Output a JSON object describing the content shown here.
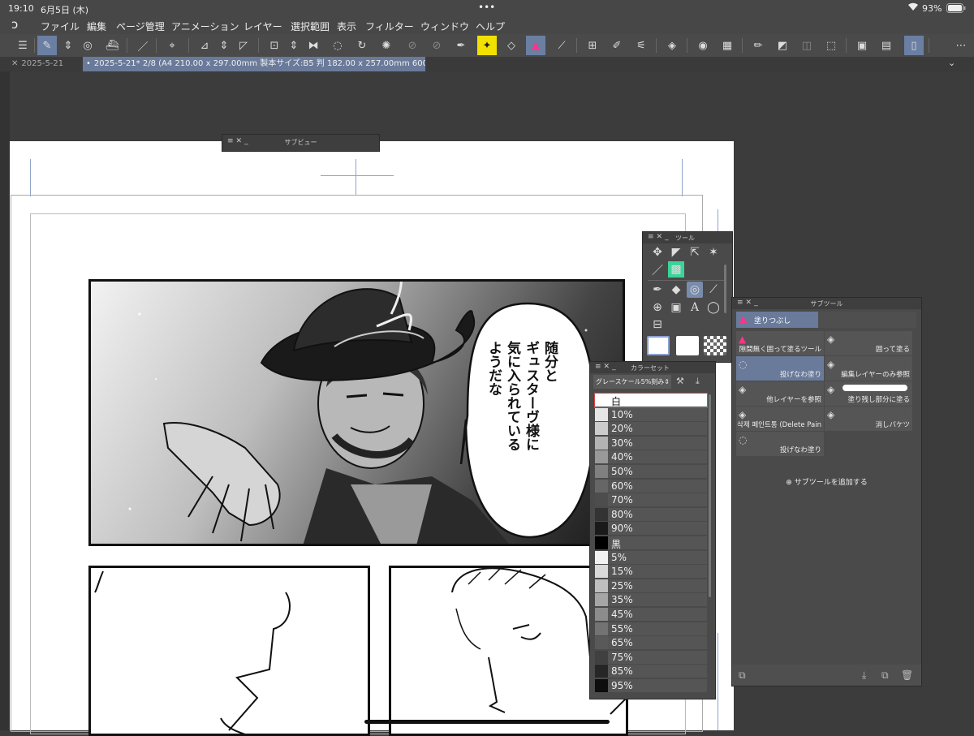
{
  "status": {
    "time": "19:10",
    "date": "6月5日 (木)",
    "dots": "•••",
    "wifi_icon": "wifi-icon",
    "battery": "93%"
  },
  "menu": {
    "items": [
      "ファイル",
      "編集",
      "ページ管理",
      "アニメーション",
      "レイヤー",
      "選択範囲",
      "表示",
      "フィルター",
      "ウィンドウ",
      "ヘルプ"
    ]
  },
  "tabs": {
    "inactive": "2025-5-21",
    "active": "2025-5-21* 2/8 (A4 210.00 x 297.00mm 製本サイズ:B5 判 182.00 x 257.00mm 600dpi 42.6%)"
  },
  "subview": {
    "title": "サブビュー"
  },
  "tool": {
    "title": "ツール"
  },
  "speech": {
    "text": "随分と\nギュスターヴ様に\n気に入られている\nようだな"
  },
  "colorset": {
    "title": "カラーセット",
    "dropdown": "グレースケール5%刻み",
    "items": [
      {
        "label": "白",
        "color": "#ffffff"
      },
      {
        "label": "10%",
        "color": "#e6e6e6"
      },
      {
        "label": "20%",
        "color": "#cccccc"
      },
      {
        "label": "30%",
        "color": "#b3b3b3"
      },
      {
        "label": "40%",
        "color": "#999999"
      },
      {
        "label": "50%",
        "color": "#808080"
      },
      {
        "label": "60%",
        "color": "#666666"
      },
      {
        "label": "70%",
        "color": "#4d4d4d"
      },
      {
        "label": "80%",
        "color": "#333333"
      },
      {
        "label": "90%",
        "color": "#1a1a1a"
      },
      {
        "label": "黒",
        "color": "#000000"
      },
      {
        "label": "5%",
        "color": "#f2f2f2"
      },
      {
        "label": "15%",
        "color": "#d9d9d9"
      },
      {
        "label": "25%",
        "color": "#bfbfbf"
      },
      {
        "label": "35%",
        "color": "#a6a6a6"
      },
      {
        "label": "45%",
        "color": "#8c8c8c"
      },
      {
        "label": "55%",
        "color": "#737373"
      },
      {
        "label": "65%",
        "color": "#595959"
      },
      {
        "label": "75%",
        "color": "#404040"
      },
      {
        "label": "85%",
        "color": "#262626"
      },
      {
        "label": "95%",
        "color": "#0d0d0d"
      }
    ]
  },
  "subtool": {
    "title": "サブツール",
    "group_tab": "塗りつぶし",
    "items": [
      "隙間無く囲って塗るツール",
      "囲って塗る",
      "投げなわ塗り",
      "編集レイヤーのみ参照",
      "他レイヤーを参照",
      "塗り残し部分に塗る",
      "삭제 페인트통 (Delete Pain",
      "消しバケツ",
      "投げなわ塗り"
    ],
    "add_label": "サブツールを追加する"
  }
}
